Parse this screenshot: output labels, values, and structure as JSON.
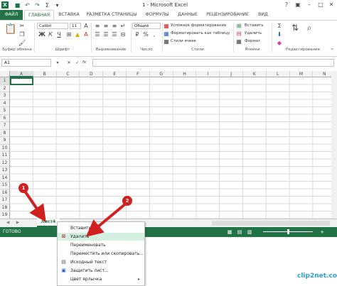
{
  "window": {
    "title": "1 - Microsoft Excel"
  },
  "tabs": [
    "ФАЙЛ",
    "ГЛАВНАЯ",
    "ВСТАВКА",
    "РАЗМЕТКА СТРАНИЦЫ",
    "ФОРМУЛЫ",
    "ДАННЫЕ",
    "РЕЦЕНЗИРОВАНИЕ",
    "ВИД"
  ],
  "ribbon": {
    "groups": {
      "clipboard": "Буфер обмена",
      "font": "Шрифт",
      "alignment": "Выравнивание",
      "number": "Число",
      "styles": "Стили",
      "cells": "Ячейки",
      "editing": "Редактирование"
    },
    "font_name": "Calibri",
    "font_size": "11",
    "number_format": "Общий",
    "styles": {
      "conditional": "Условное форматирование",
      "table": "Форматировать как таблицу",
      "cell_styles": "Стили ячеек"
    },
    "cells": {
      "insert": "Вставить",
      "delete": "Удалить",
      "format": "Формат"
    }
  },
  "namebox": "A1",
  "fx": "fx",
  "columns": [
    "A",
    "B",
    "C",
    "D",
    "E",
    "F",
    "G",
    "H",
    "I",
    "J",
    "K",
    "L",
    "M",
    "N"
  ],
  "rows": [
    "1",
    "2",
    "3",
    "4",
    "5",
    "6",
    "7",
    "8",
    "9",
    "10",
    "11",
    "12",
    "13",
    "14",
    "15",
    "16",
    "17",
    "18",
    "19"
  ],
  "sheet_tab": "Лист4",
  "status": "ГОТОВО",
  "context_menu": [
    "Вставить...",
    "Удалить",
    "Переименовать",
    "Переместить или скопировать...",
    "Исходный текст",
    "Защитить лист...",
    "Цвет ярлычка"
  ],
  "annotations": {
    "badge1": "1",
    "badge2": "2"
  },
  "watermark": "clip2net.com"
}
